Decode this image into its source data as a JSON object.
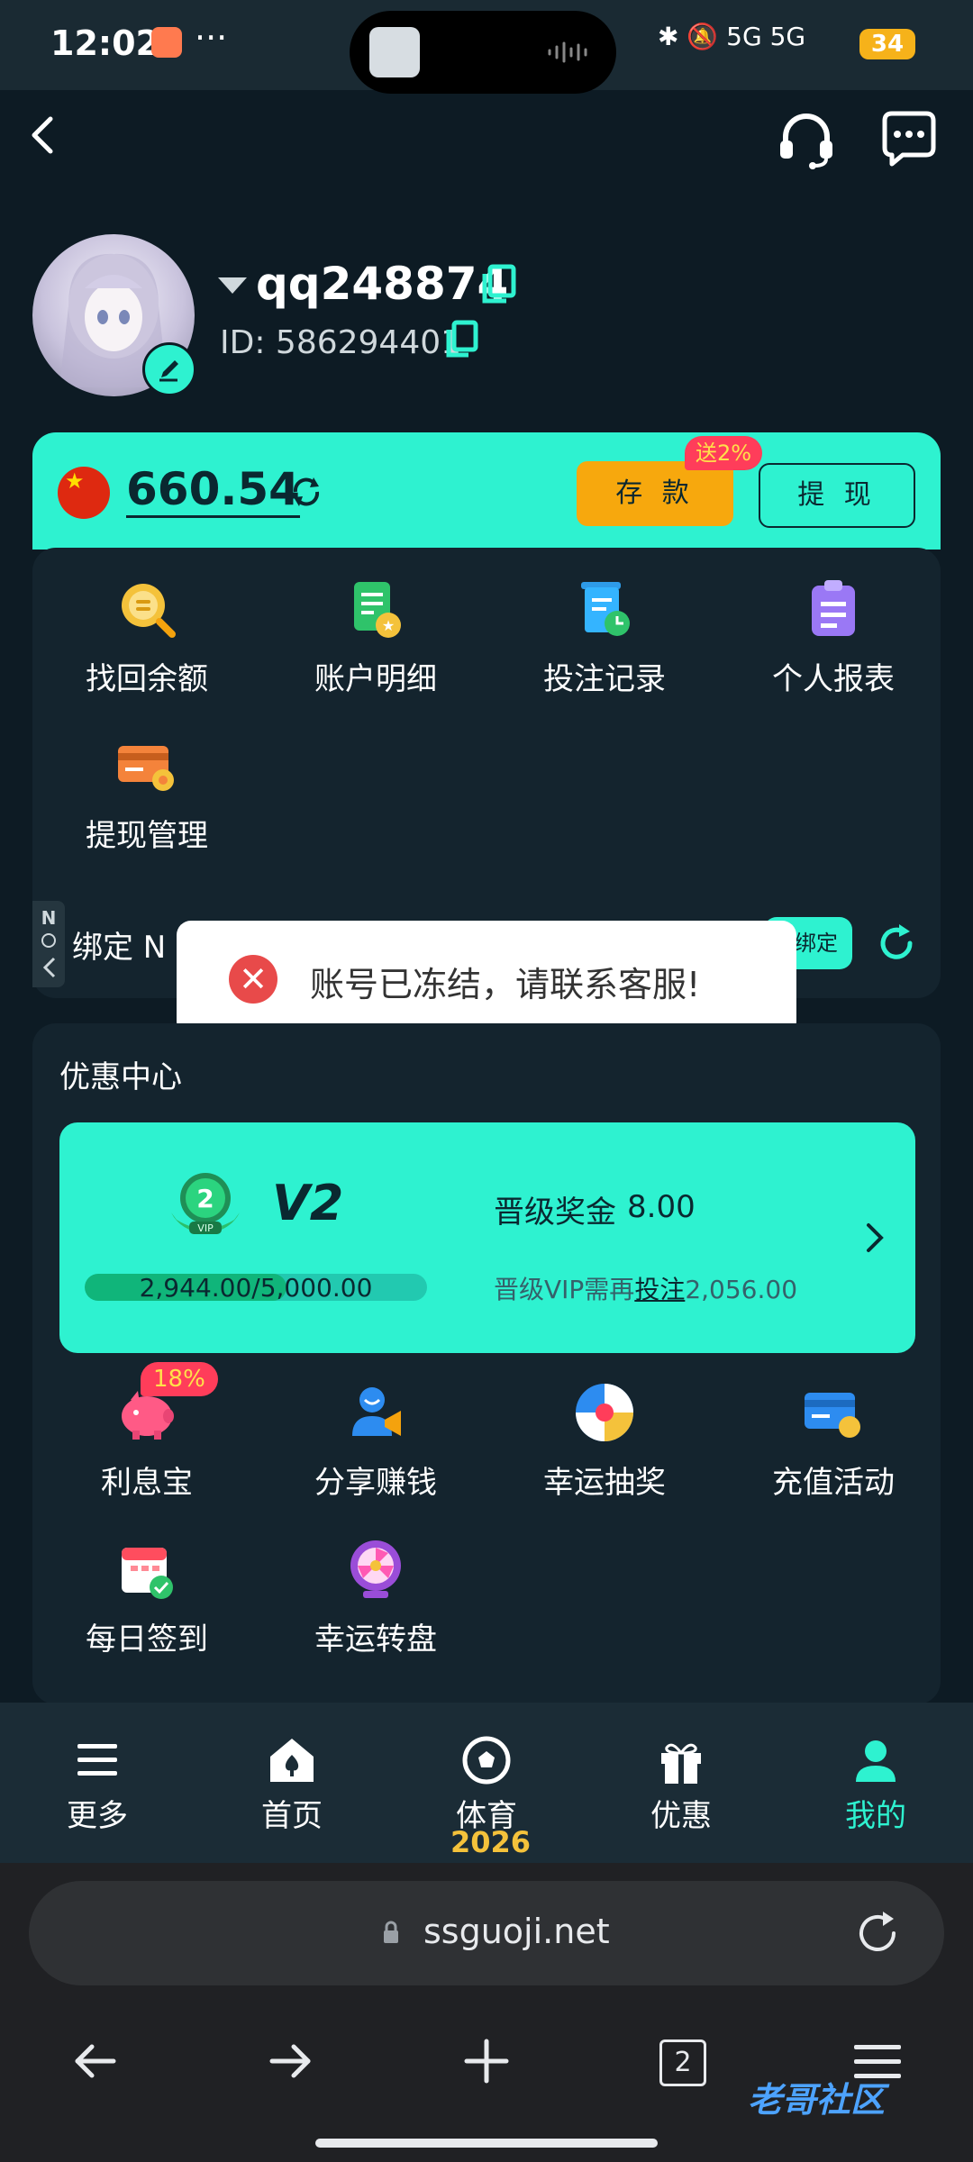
{
  "status_bar": {
    "time": "12:02",
    "more": "···",
    "network": "5G 5G",
    "battery": "34"
  },
  "header": {
    "back_icon": "chevron-left-icon",
    "support_icon": "headset-icon",
    "message_icon": "chat-bubble-icon"
  },
  "profile": {
    "username": "qq248874",
    "user_id": "ID: 586294401"
  },
  "wallet": {
    "balance": "660.54",
    "deposit_label": "存 款",
    "deposit_badge": "送2%",
    "withdraw_label": "提 现",
    "accent": "#2ef2d0",
    "deposit_color": "#f7a80d"
  },
  "account_menu": [
    {
      "label": "找回余额",
      "icon": "coin-search-icon"
    },
    {
      "label": "账户明细",
      "icon": "account-detail-icon"
    },
    {
      "label": "投注记录",
      "icon": "bet-record-icon"
    },
    {
      "label": "个人报表",
      "icon": "report-icon"
    },
    {
      "label": "提现管理",
      "icon": "card-gear-icon"
    }
  ],
  "bind_row": {
    "label": "绑定 N",
    "button": "绑定"
  },
  "toast": {
    "message": "账号已冻结，请联系客服!"
  },
  "promo": {
    "title": "优惠中心",
    "vip": {
      "badge_number": "2",
      "badge_text": "VIP",
      "level": "V2",
      "progress_text": "2,944.00/5,000.00",
      "progress_fraction": 0.5888,
      "bonus_label": "晋级奖金",
      "bonus_value": "8.00",
      "requirement_prefix": "晋级VIP需再",
      "requirement_link": "投注",
      "requirement_amount": "2,056.00"
    },
    "items": [
      {
        "label": "利息宝",
        "icon": "piggy-bank-icon",
        "badge": "18%"
      },
      {
        "label": "分享赚钱",
        "icon": "share-megaphone-icon"
      },
      {
        "label": "幸运抽奖",
        "icon": "lucky-wheel-icon"
      },
      {
        "label": "充值活动",
        "icon": "card-coin-icon"
      },
      {
        "label": "每日签到",
        "icon": "calendar-check-icon"
      },
      {
        "label": "幸运转盘",
        "icon": "prize-wheel-icon"
      }
    ]
  },
  "bottom_nav": [
    {
      "label": "更多",
      "icon": "menu-icon"
    },
    {
      "label": "首页",
      "icon": "home-spade-icon"
    },
    {
      "label": "体育",
      "icon": "soccer-ball-icon"
    },
    {
      "label": "优惠",
      "icon": "gift-icon"
    },
    {
      "label": "我的",
      "icon": "user-icon",
      "active": true
    }
  ],
  "decoration": {
    "year": "2026"
  },
  "browser": {
    "url": "ssguoji.net",
    "tab_count": "2",
    "watermark": "老哥社区"
  }
}
